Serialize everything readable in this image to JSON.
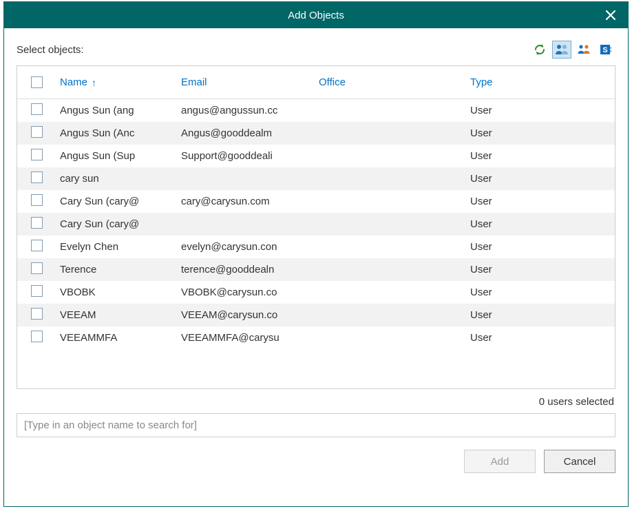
{
  "title": "Add Objects",
  "topLabel": "Select objects:",
  "toolbarIcons": [
    "refresh-icon",
    "users-icon",
    "user-groups-icon",
    "sharepoint-icon"
  ],
  "columns": {
    "name": "Name",
    "email": "Email",
    "office": "Office",
    "type": "Type"
  },
  "sortIndicator": "↑",
  "rows": [
    {
      "name": "Angus Sun (ang",
      "email": "angus@angussun.cc",
      "office": "",
      "type": "User"
    },
    {
      "name": "Angus Sun (Anc",
      "email": "Angus@gooddealm",
      "office": "",
      "type": "User"
    },
    {
      "name": "Angus Sun (Sup",
      "email": "Support@gooddeali",
      "office": "",
      "type": "User"
    },
    {
      "name": "cary sun",
      "email": "",
      "office": "",
      "type": "User"
    },
    {
      "name": "Cary Sun (cary@",
      "email": "cary@carysun.com",
      "office": "",
      "type": "User"
    },
    {
      "name": "Cary Sun (cary@",
      "email": "",
      "office": "",
      "type": "User"
    },
    {
      "name": "Evelyn Chen",
      "email": "evelyn@carysun.con",
      "office": "",
      "type": "User"
    },
    {
      "name": "Terence",
      "email": "terence@gooddealn",
      "office": "",
      "type": "User"
    },
    {
      "name": "VBOBK",
      "email": "VBOBK@carysun.co",
      "office": "",
      "type": "User"
    },
    {
      "name": "VEEAM",
      "email": "VEEAM@carysun.co",
      "office": "",
      "type": "User"
    },
    {
      "name": "VEEAMMFA",
      "email": "VEEAMMFA@carysu",
      "office": "",
      "type": "User"
    }
  ],
  "statusText": "0 users selected",
  "searchPlaceholder": "[Type in an object name to search for]",
  "buttons": {
    "add": "Add",
    "cancel": "Cancel"
  }
}
